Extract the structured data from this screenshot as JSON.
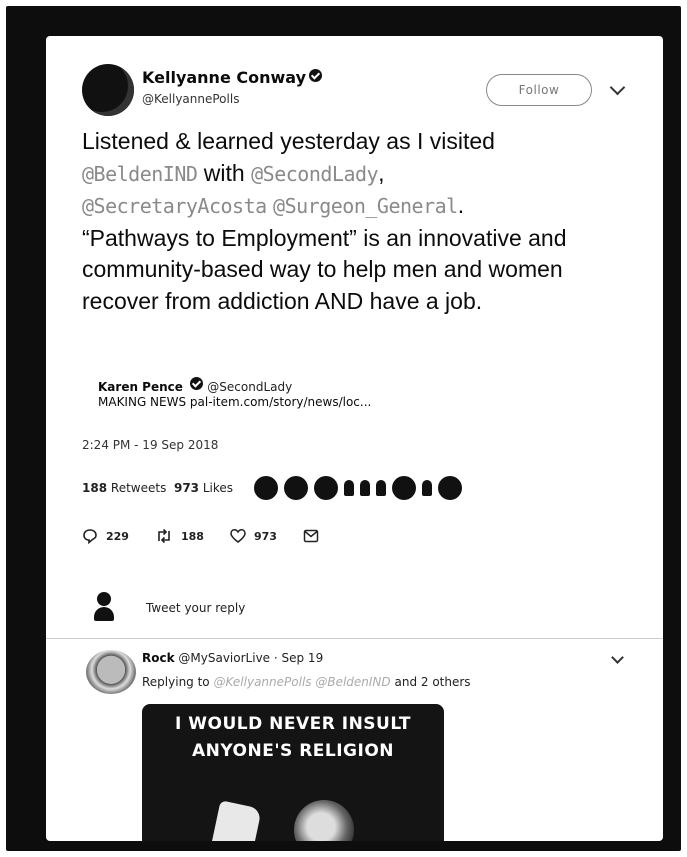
{
  "author": {
    "name": "Kellyanne Conway",
    "handle": "@KellyannePolls"
  },
  "follow_label": "Follow",
  "tweet": {
    "t1": "Listened & learned yesterday as I visited",
    "m1": "@BeldenIND",
    "t2": " with ",
    "m2": "@SecondLady",
    "t3": ",",
    "m3": "@SecretaryAcosta",
    "t4": " ",
    "m4": "@Surgeon_General",
    "t5": ".",
    "t6": "“Pathways to Employment” is an innovative and community-based way to help men and women recover from addiction AND have a job."
  },
  "quote": {
    "name": "Karen Pence",
    "handle": "@SecondLady",
    "text": "MAKING NEWS pal-item.com/story/news/loc..."
  },
  "timestamp": "2:24 PM - 19 Sep 2018",
  "stats": {
    "retweets": "188",
    "retweets_label": "Retweets",
    "likes": "973",
    "likes_label": "Likes"
  },
  "actions": {
    "replies": "229",
    "retweets": "188",
    "likes": "973"
  },
  "reply_prompt": "Tweet your reply",
  "reply": {
    "name": "Rock",
    "handle": "@MySaviorLive",
    "date": "· Sep 19",
    "replying_prefix": "Replying to",
    "replying_faded": "@KellyannePolls @BeldenIND",
    "replying_suffix": "and 2 others"
  },
  "meme": {
    "line1": "I WOULD NEVER INSULT",
    "line2": "ANYONE'S RELIGION"
  }
}
